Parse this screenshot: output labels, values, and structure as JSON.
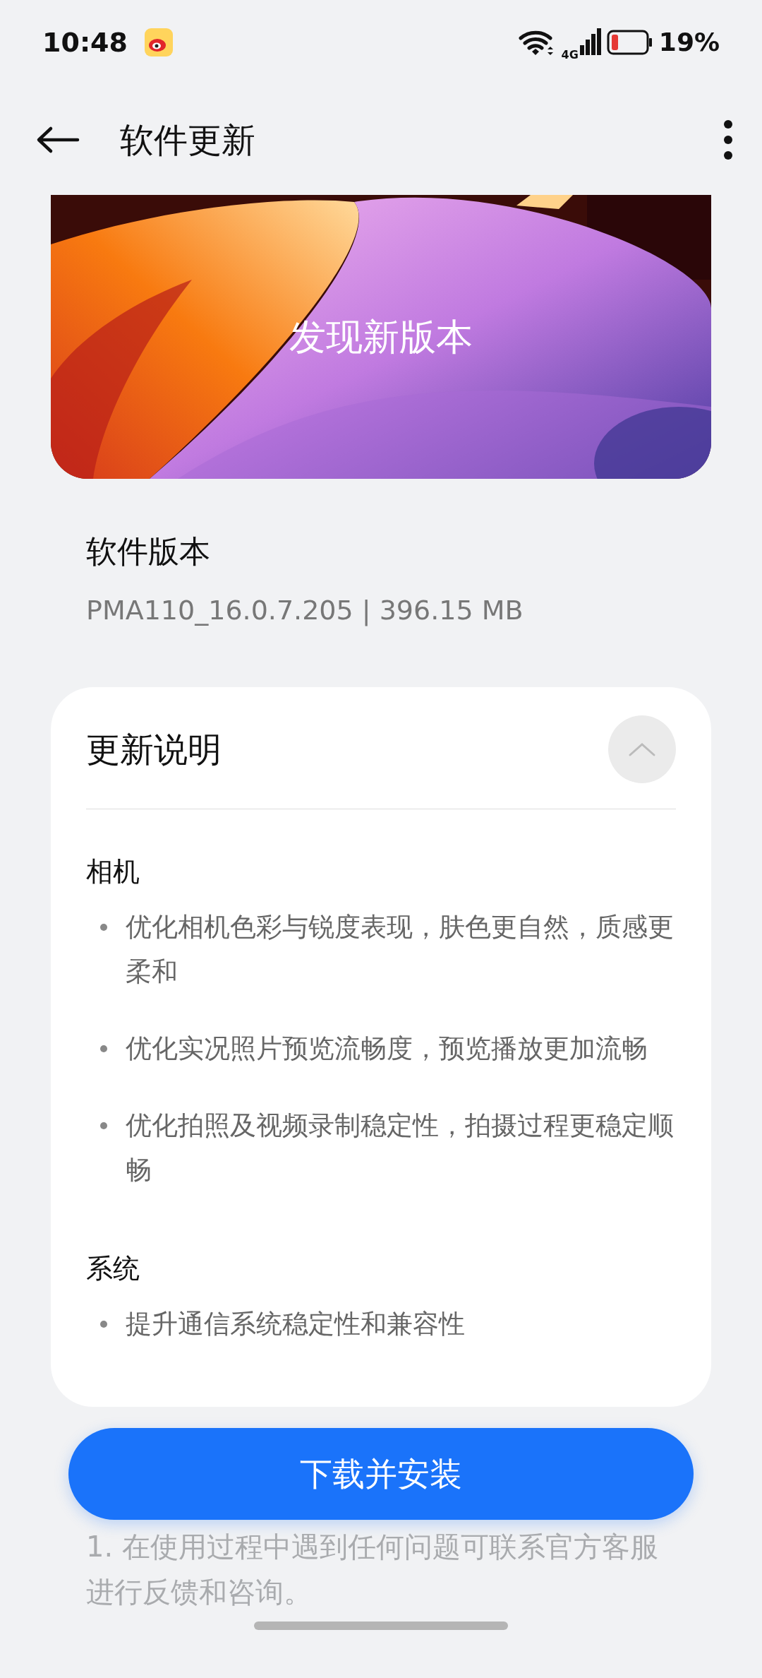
{
  "status_bar": {
    "time": "10:48",
    "network": "4G",
    "battery": "19%"
  },
  "header": {
    "title": "软件更新"
  },
  "banner": {
    "kind": "picture",
    "title": "发现新版本"
  },
  "version": {
    "label": "软件版本",
    "value": "PMA110_16.0.7.205 | 396.15 MB"
  },
  "notes": {
    "title": "更新说明",
    "expanded": true,
    "sections": [
      {
        "heading": "相机",
        "items": [
          "优化相机色彩与锐度表现，肤色更自然，质感更柔和",
          "优化实况照片预览流畅度，预览播放更加流畅",
          "优化拍照及视频录制稳定性，拍摄过程更稳定顺畅"
        ]
      },
      {
        "heading": "系统",
        "items": [
          "提升通信系统稳定性和兼容性"
        ]
      }
    ]
  },
  "action": {
    "label": "下载并安装"
  },
  "footnote": "1. 在使用过程中遇到任何问题可联系官方客服进行反馈和咨询。"
}
